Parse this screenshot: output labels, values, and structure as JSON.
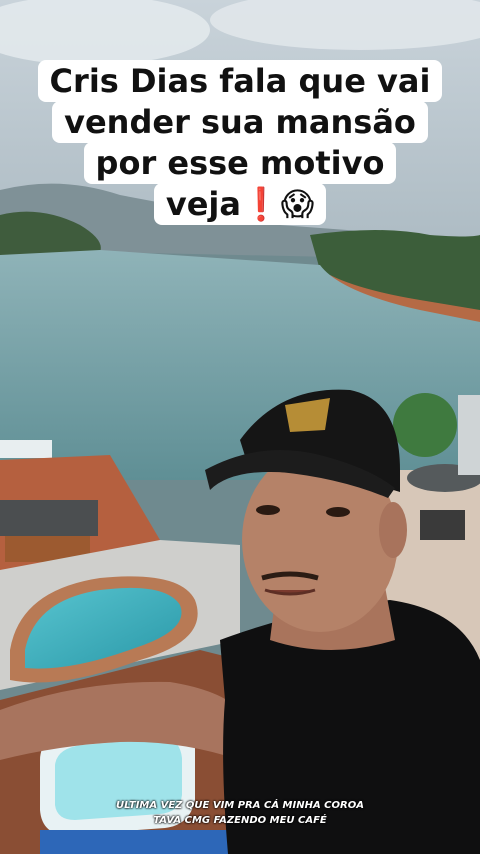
{
  "caption": {
    "line1": "Cris Dias fala que vai",
    "line2": "vender sua mansão",
    "line3": "por esse motivo",
    "line4": "veja❗😱"
  },
  "subtitles": {
    "line1": "ULTIMA VEZ QUE VIM PRA CÁ MINHA COROA",
    "line2": "TAVA CMG FAZENDO MEU CAFÉ"
  }
}
